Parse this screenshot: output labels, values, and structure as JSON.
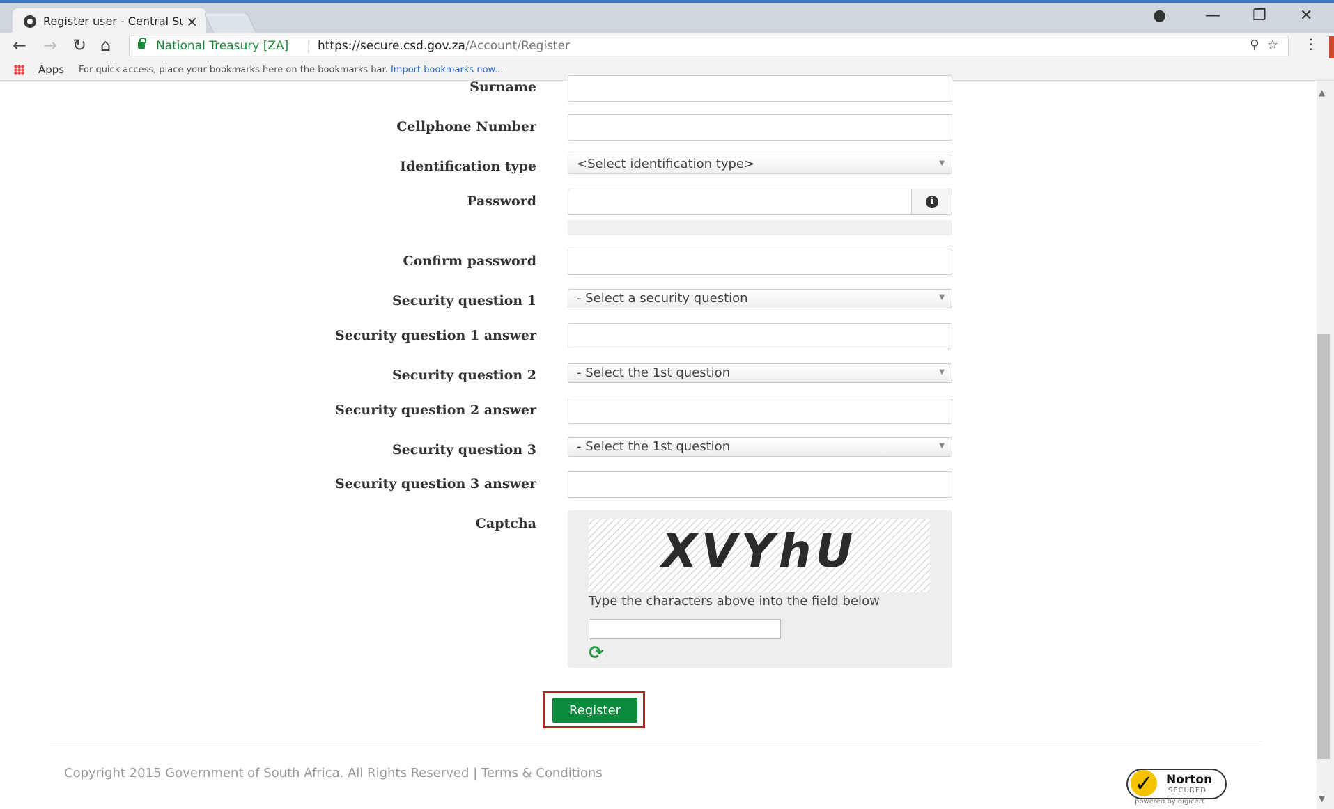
{
  "browser": {
    "tab_title": "Register user - Central Su",
    "tab_close": "×",
    "secure_name": "National Treasury [ZA]",
    "url_base": "https://secure.csd.gov.za",
    "url_path": "/Account/Register",
    "apps_label": "Apps",
    "bookmarks_hint": "For quick access, place your bookmarks here on the bookmarks bar.",
    "bookmarks_link": "Import bookmarks now..."
  },
  "form": {
    "surname_label": "Surname",
    "cellphone_label": "Cellphone Number",
    "id_type_label": "Identification type",
    "id_type_value": "<Select identification type>",
    "password_label": "Password",
    "confirm_password_label": "Confirm password",
    "sq1_label": "Security question 1",
    "sq1_value": "- Select a security question",
    "sq1_answer_label": "Security question 1 answer",
    "sq2_label": "Security question 2",
    "sq2_value": "- Select the 1st question",
    "sq2_answer_label": "Security question 2 answer",
    "sq3_label": "Security question 3",
    "sq3_value": "- Select the 1st question",
    "sq3_answer_label": "Security question 3 answer",
    "captcha_label": "Captcha",
    "captcha_text": "XVYhU",
    "captcha_hint": "Type the characters above into the field below",
    "register_label": "Register"
  },
  "footer": {
    "copyright": "Copyright 2015 Government of South Africa. All Rights Reserved | Terms & Conditions",
    "norton_name": "Norton",
    "norton_secured": "SECURED",
    "norton_powered": "powered by digicert"
  },
  "colors": {
    "accent_green": "#0a8a3c",
    "highlight_red": "#b22222",
    "secure_green": "#1a8a3a"
  }
}
